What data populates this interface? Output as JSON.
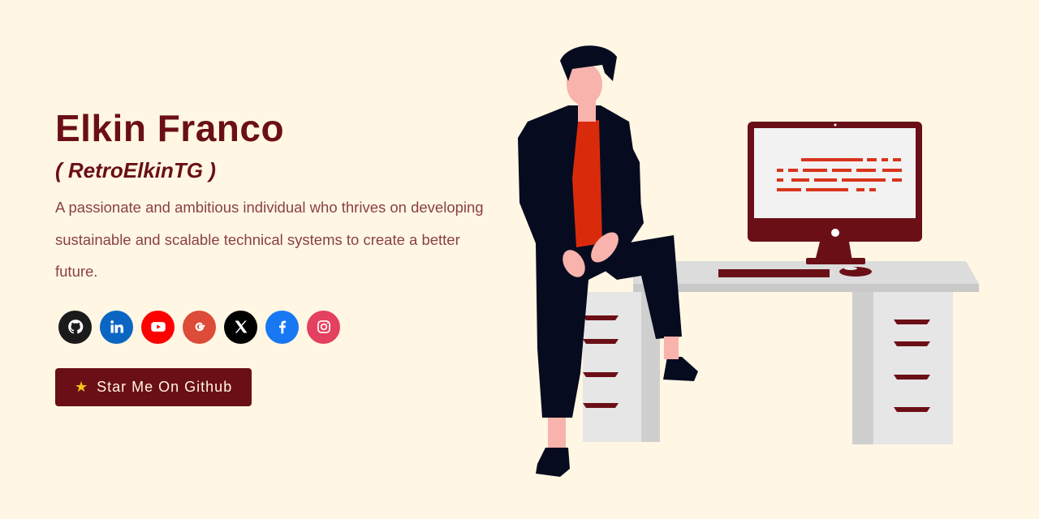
{
  "profile": {
    "name": "Elkin Franco",
    "handle": "( RetroElkinTG )",
    "bio": "A passionate and ambitious individual who thrives on developing sustainable and scalable technical systems to create a better future."
  },
  "socials": [
    {
      "name": "github",
      "icon": "github-icon",
      "color": "#1b1b1b"
    },
    {
      "name": "linkedin",
      "icon": "linkedin-icon",
      "color": "#0a66c2"
    },
    {
      "name": "youtube",
      "icon": "youtube-icon",
      "color": "#ff0000"
    },
    {
      "name": "google",
      "icon": "google-icon",
      "color": "#dd4b39"
    },
    {
      "name": "x",
      "icon": "x-icon",
      "color": "#000000"
    },
    {
      "name": "facebook",
      "icon": "facebook-icon",
      "color": "#1877f2"
    },
    {
      "name": "instagram",
      "icon": "instagram-icon",
      "color": "#e4405f"
    }
  ],
  "cta": {
    "label": "Star Me On Github",
    "icon": "star-icon"
  },
  "colors": {
    "background": "#fff7e3",
    "accent": "#6b0f16",
    "text": "#8a3f45"
  }
}
